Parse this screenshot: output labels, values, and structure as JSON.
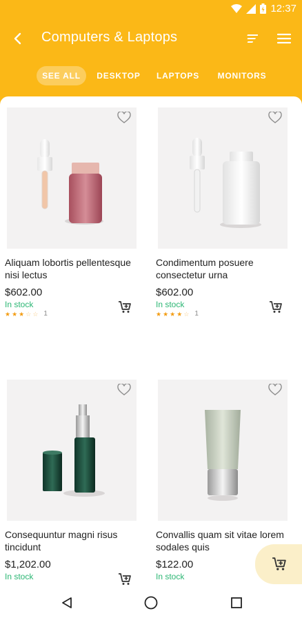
{
  "status_bar": {
    "time": "12:37",
    "icons": [
      "wifi-icon",
      "signal-icon",
      "battery-icon"
    ]
  },
  "app_bar": {
    "title": "Computers & Laptops",
    "back_icon": "arrow-left-icon",
    "sort_icon": "sort-icon",
    "menu_icon": "hamburger-menu-icon"
  },
  "tabs": [
    {
      "label": "SEE ALL",
      "active": true
    },
    {
      "label": "DESKTOP",
      "active": false
    },
    {
      "label": "LAPTOPS",
      "active": false
    },
    {
      "label": "MONITORS",
      "active": false
    }
  ],
  "products": [
    {
      "name": "Aliquam lobortis pellentesque nisi lectus",
      "price": "$602.00",
      "stock": "In stock",
      "rating": 3,
      "rating_count": "1",
      "image": "dropper-bottle-pink"
    },
    {
      "name": "Condimentum posuere consectetur urna",
      "price": "$602.00",
      "stock": "In stock",
      "rating": 4,
      "rating_count": "1",
      "image": "dropper-bottle-white"
    },
    {
      "name": "Consequuntur magni risus tincidunt",
      "price": "$1,202.00",
      "stock": "In stock",
      "rating": 0,
      "rating_count": "",
      "image": "pump-bottle-green"
    },
    {
      "name": "Convallis quam sit vitae lorem sodales quis",
      "price": "$122.00",
      "stock": "In stock",
      "rating": 0,
      "rating_count": "",
      "image": "tube-cream"
    }
  ],
  "colors": {
    "primary": "#fbb817",
    "stock_green": "#2bb673",
    "star": "#f39c12",
    "fab_bg": "#fbefc9"
  }
}
